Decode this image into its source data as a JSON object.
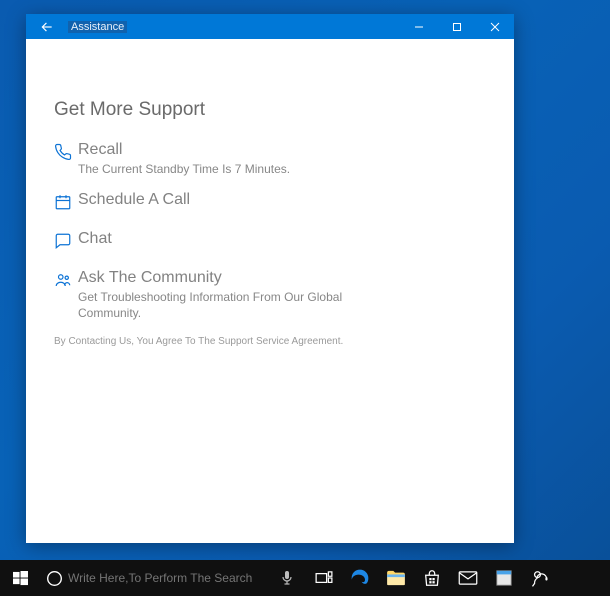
{
  "window": {
    "title": "Assistance",
    "controls": {
      "min": "min",
      "max": "max",
      "close": "close"
    }
  },
  "content": {
    "heading": "Get More Support",
    "options": [
      {
        "icon": "phone-icon",
        "label": "Recall",
        "sub": "The Current Standby Time Is 7 Minutes."
      },
      {
        "icon": "calendar-icon",
        "label": "Schedule A Call",
        "sub": ""
      },
      {
        "icon": "chat-icon",
        "label": "Chat",
        "sub": ""
      },
      {
        "icon": "community-icon",
        "label": "Ask The Community",
        "sub": "Get Troubleshooting Information From Our Global Community."
      }
    ],
    "agreement": "By Contacting Us, You Agree To The Support Service Agreement."
  },
  "taskbar": {
    "search_placeholder": "Write Here,To Perform The Search"
  }
}
